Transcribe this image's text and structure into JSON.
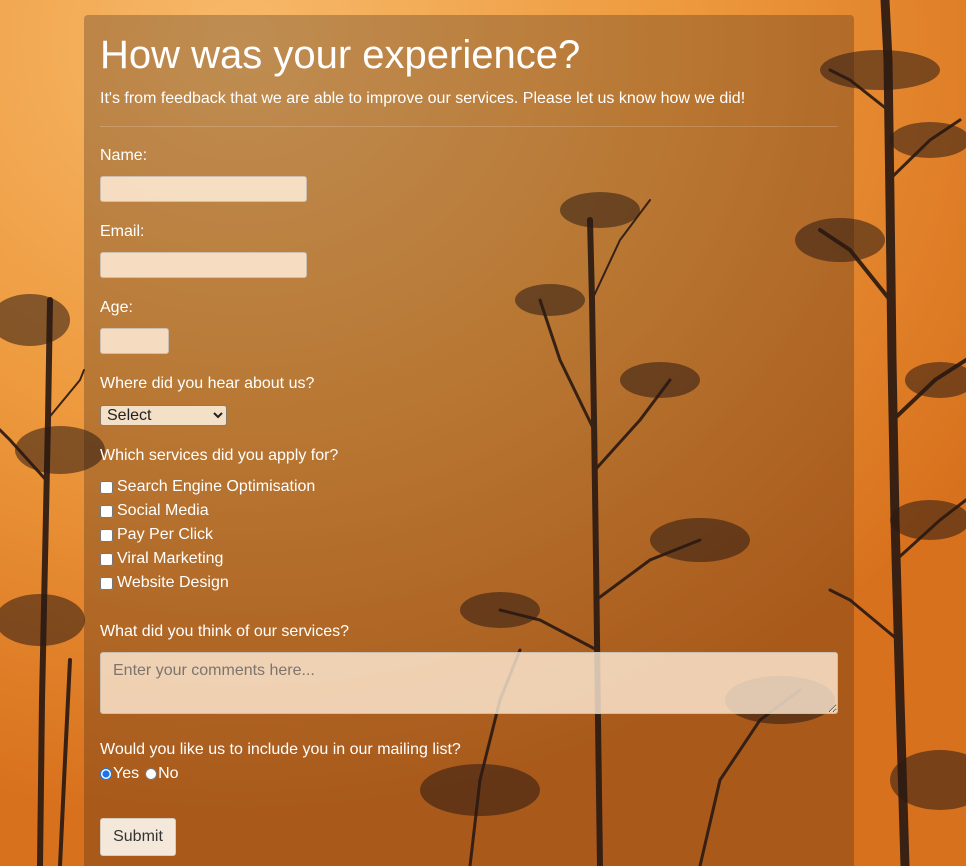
{
  "page": {
    "title": "How was your experience?",
    "subtitle": "It's from feedback that we are able to improve our services. Please let us know how we did!"
  },
  "form": {
    "name": {
      "label": "Name:",
      "value": "",
      "placeholder": ""
    },
    "email": {
      "label": "Email:",
      "value": "",
      "placeholder": ""
    },
    "age": {
      "label": "Age:",
      "value": "",
      "placeholder": ""
    },
    "source": {
      "label": "Where did you hear about us?",
      "selected": "Select",
      "options": [
        "Select"
      ]
    },
    "services": {
      "label": "Which services did you apply for?",
      "items": [
        {
          "label": "Search Engine Optimisation",
          "checked": false
        },
        {
          "label": "Social Media",
          "checked": false
        },
        {
          "label": "Pay Per Click",
          "checked": false
        },
        {
          "label": "Viral Marketing",
          "checked": false
        },
        {
          "label": "Website Design",
          "checked": false
        }
      ]
    },
    "comments": {
      "label": "What did you think of our services?",
      "placeholder": "Enter your comments here...",
      "value": ""
    },
    "mailing_list": {
      "label": "Would you like us to include you in our mailing list?",
      "options": [
        {
          "label": "Yes",
          "checked": true
        },
        {
          "label": "No",
          "checked": false
        }
      ]
    },
    "submit_label": "Submit"
  },
  "colors": {
    "background_top": "#f0a552",
    "background_bottom": "#d56f1c",
    "panel_overlay": "rgba(45,30,20,0.28)",
    "text": "#ffffff",
    "radio_accent": "#1a73e8"
  },
  "background": {
    "description_icon": "pine-tree-silhouette"
  }
}
